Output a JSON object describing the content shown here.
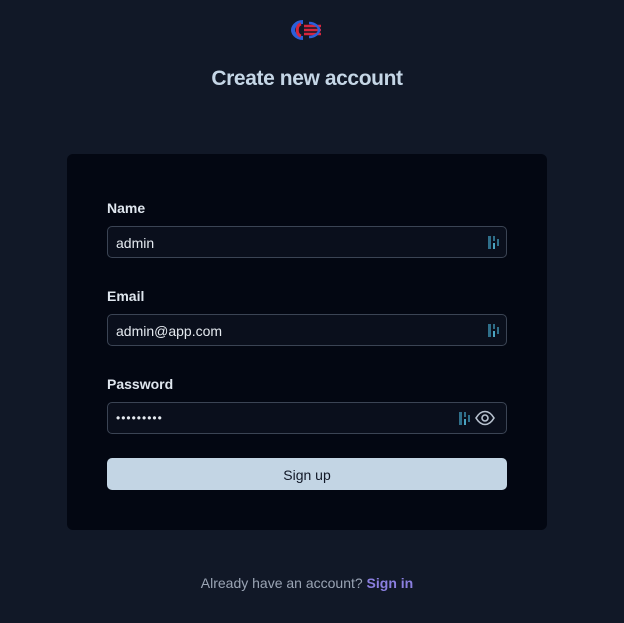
{
  "header": {
    "title": "Create new account"
  },
  "form": {
    "name": {
      "label": "Name",
      "value": "admin"
    },
    "email": {
      "label": "Email",
      "value": "admin@app.com"
    },
    "password": {
      "label": "Password",
      "value": "•••••••••"
    },
    "submit_label": "Sign up"
  },
  "footer": {
    "prompt": "Already have an account?",
    "link_label": "Sign in"
  },
  "icons": {
    "logo": "app-logo-icon",
    "field_extension": "password-manager-icon",
    "show_password": "eye-icon"
  },
  "colors": {
    "background": "#111827",
    "card": "#030712",
    "title": "#c5d6e6",
    "button": "#c3d5e4",
    "link": "#8b7fe0",
    "logo_red": "#d7263d",
    "logo_blue": "#2b5fd9"
  }
}
